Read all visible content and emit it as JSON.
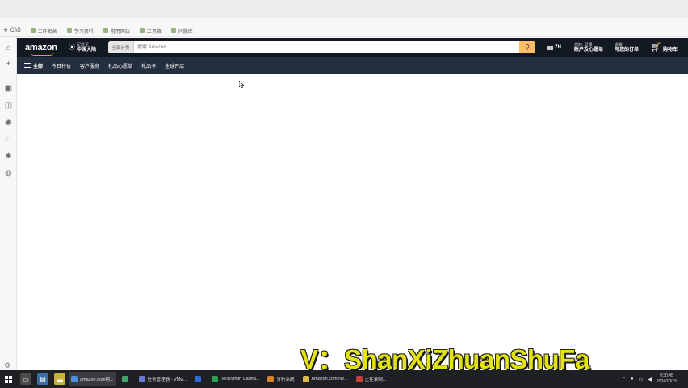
{
  "browser": {
    "bookmarks": [
      {
        "label": "CAD",
        "icon": "star-icon"
      },
      {
        "label": "工作相关",
        "icon": "folder-icon"
      },
      {
        "label": "学习资料",
        "icon": "folder-icon"
      },
      {
        "label": "常用网站",
        "icon": "folder-icon"
      },
      {
        "label": "工具箱",
        "icon": "folder-icon"
      },
      {
        "label": "问题库",
        "icon": "folder-icon"
      }
    ]
  },
  "amazon": {
    "logo": "amazon",
    "location_line1": "配送至",
    "location_line2": "中国大陆",
    "search_category": "全部分类",
    "search_placeholder": "搜索 Amazon",
    "language": "ZH",
    "account_line1": "您好, 登录",
    "account_line2": "账户及心愿单",
    "orders_line1": "退货",
    "orders_line2": "与您的订单",
    "cart_count": "0",
    "cart_label": "购物车",
    "all_label": "全部",
    "subnav": [
      "今日特价",
      "客户服务",
      "礼品心愿单",
      "礼品卡",
      "全球开店"
    ]
  },
  "watermark": "V：ShanXiZhuanShuFa",
  "taskbar": {
    "apps": [
      {
        "label": "amazon.com购...",
        "color": "#4a8fe0"
      },
      {
        "label": "",
        "color": "#3fa46a"
      },
      {
        "label": "任务管理器 - VMw...",
        "color": "#6b79d6"
      },
      {
        "label": "",
        "color": "#2f6bd1"
      },
      {
        "label": "TechSmith Camta...",
        "color": "#2e9c55"
      },
      {
        "label": "分析系统",
        "color": "#d9822b"
      },
      {
        "label": "Amazon.com Ne...",
        "color": "#e0b84a"
      },
      {
        "label": "正在录制...",
        "color": "#c24040"
      }
    ],
    "time": "9:30:45",
    "date": "2024/10/15"
  }
}
